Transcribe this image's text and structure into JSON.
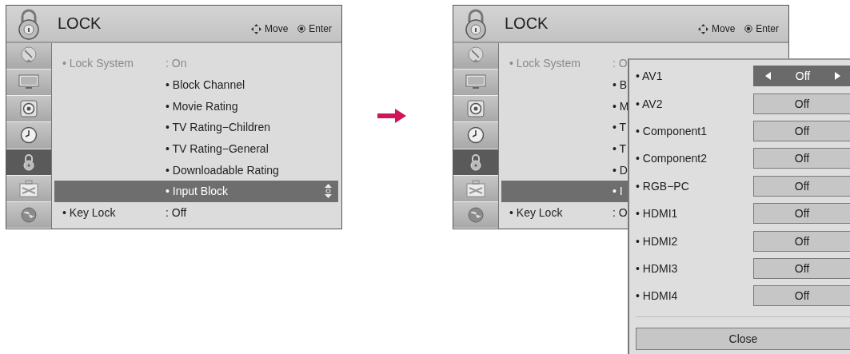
{
  "panels": [
    {
      "header": {
        "title": "LOCK",
        "hints": [
          {
            "kind": "move",
            "label": "Move"
          },
          {
            "kind": "enter",
            "label": "Enter"
          }
        ]
      },
      "sidebar": [
        {
          "selected": false
        },
        {
          "selected": false
        },
        {
          "selected": false
        },
        {
          "selected": false
        },
        {
          "selected": true
        },
        {
          "selected": false
        },
        {
          "selected": false
        }
      ],
      "rows": [
        {
          "kind": "setting",
          "label": "• Lock System",
          "value": ": On",
          "disabled": true
        },
        {
          "kind": "sub",
          "text": "• Block Channel",
          "selected": false
        },
        {
          "kind": "sub",
          "text": "• Movie Rating",
          "selected": false
        },
        {
          "kind": "sub",
          "text": "• TV Rating−Children",
          "selected": false
        },
        {
          "kind": "sub",
          "text": "• TV Rating−General",
          "selected": false
        },
        {
          "kind": "sub",
          "text": "• Downloadable Rating",
          "selected": false
        },
        {
          "kind": "sub",
          "text": "• Input Block",
          "selected": true
        },
        {
          "kind": "setting",
          "label": "• Key Lock",
          "value": ": Off",
          "disabled": false
        }
      ]
    },
    {
      "header": {
        "title": "LOCK",
        "hints": [
          {
            "kind": "move",
            "label": "Move"
          },
          {
            "kind": "enter",
            "label": "Enter"
          }
        ]
      },
      "sidebar": [
        {
          "selected": false
        },
        {
          "selected": false
        },
        {
          "selected": false
        },
        {
          "selected": false
        },
        {
          "selected": true
        },
        {
          "selected": false
        },
        {
          "selected": false
        }
      ],
      "rows": [
        {
          "kind": "setting",
          "label": "• Lock System",
          "value": ": O",
          "disabled": true
        },
        {
          "kind": "sub",
          "text": "• B",
          "selected": false
        },
        {
          "kind": "sub",
          "text": "• M",
          "selected": false
        },
        {
          "kind": "sub",
          "text": "• T",
          "selected": false
        },
        {
          "kind": "sub",
          "text": "• T",
          "selected": false
        },
        {
          "kind": "sub",
          "text": "• D",
          "selected": false
        },
        {
          "kind": "sub",
          "text": "• I",
          "selected": true
        },
        {
          "kind": "setting",
          "label": "• Key Lock",
          "value": ": O",
          "disabled": false
        }
      ],
      "popup": {
        "inputs": [
          {
            "label": "• AV1",
            "value": "Off",
            "selected": true
          },
          {
            "label": "• AV2",
            "value": "Off",
            "selected": false
          },
          {
            "label": "• Component1",
            "value": "Off",
            "selected": false
          },
          {
            "label": "• Component2",
            "value": "Off",
            "selected": false
          },
          {
            "label": "• RGB−PC",
            "value": "Off",
            "selected": false
          },
          {
            "label": "• HDMI1",
            "value": "Off",
            "selected": false
          },
          {
            "label": "• HDMI2",
            "value": "Off",
            "selected": false
          },
          {
            "label": "• HDMI3",
            "value": "Off",
            "selected": false
          },
          {
            "label": "• HDMI4",
            "value": "Off",
            "selected": false
          }
        ],
        "close": "Close"
      }
    }
  ]
}
